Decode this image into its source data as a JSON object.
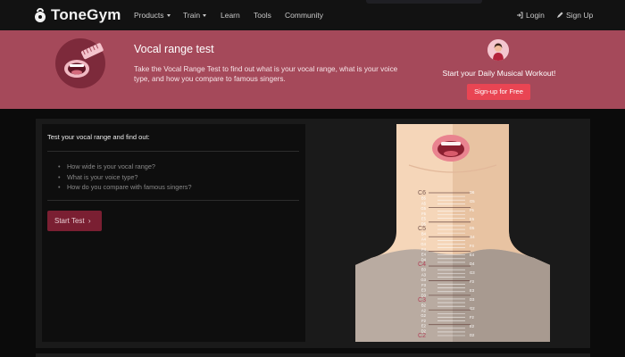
{
  "brand": {
    "name": "ToneGym"
  },
  "nav": {
    "items": [
      {
        "label": "Products",
        "dropdown": true
      },
      {
        "label": "Train",
        "dropdown": true
      },
      {
        "label": "Learn",
        "dropdown": false
      },
      {
        "label": "Tools",
        "dropdown": false
      },
      {
        "label": "Community",
        "dropdown": false
      }
    ],
    "login": "Login",
    "signup": "Sign Up"
  },
  "hero": {
    "title": "Vocal range test",
    "description": "Take the Vocal Range Test to find out what is your vocal range, what is your voice type, and how you compare to famous singers.",
    "cta_text": "Start your Daily Musical Workout!",
    "cta_button": "Sign-up for Free"
  },
  "card": {
    "title": "Test your vocal range and find out:",
    "items": [
      "How wide is your vocal range?",
      "What is your voice type?",
      "How do you compare with famous singers?"
    ],
    "start_button": "Start Test",
    "start_icon": "chevron-right-icon"
  },
  "scale": {
    "left_labels": [
      "C6",
      "B5",
      "A5",
      "G5",
      "F5",
      "E5",
      "D5",
      "C5",
      "B4",
      "A4",
      "G4",
      "F4",
      "E4",
      "D4",
      "C4",
      "B3",
      "A3",
      "G3",
      "F3",
      "E3",
      "D3",
      "C3",
      "B2",
      "A2",
      "G2",
      "F2",
      "E2",
      "D2",
      "C2"
    ],
    "right_labels": [
      "D6",
      "G5",
      "F5",
      "E5",
      "D5",
      "G4",
      "F4",
      "E4",
      "D4",
      "G3",
      "F3",
      "E3",
      "D3",
      "G2",
      "F2",
      "E2",
      "D2"
    ]
  },
  "colors": {
    "hero_bg": "#a5495a",
    "cta": "#e94553",
    "start": "#7a1f32",
    "accent_label": "#b2455a"
  }
}
